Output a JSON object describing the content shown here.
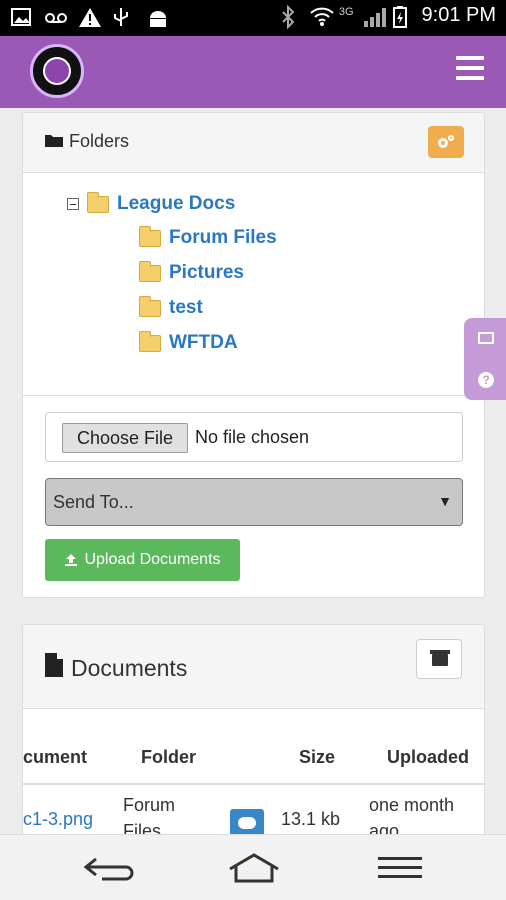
{
  "status_bar": {
    "network": "3G",
    "time": "9:01 PM"
  },
  "app_bar": {
    "logo_alt": "league logo",
    "menu_icon": "hamburger-menu-icon"
  },
  "folders_panel": {
    "title": "Folders",
    "tree": {
      "root": "League Docs",
      "children": [
        "Forum Files",
        "Pictures",
        "test",
        "WFTDA"
      ]
    }
  },
  "upload": {
    "choose_label": "Choose File",
    "no_file_text": "No file chosen",
    "send_to_value": "Send To...",
    "upload_label": "Upload Documents"
  },
  "documents_panel": {
    "title": "Documents",
    "columns": [
      "cument",
      "Folder",
      "Size",
      "Uploaded"
    ],
    "rows": [
      {
        "name": "c1-3.png",
        "folder_line1": "Forum",
        "folder_line2": "Files",
        "size": "13.1 kb",
        "uploaded_line1": "one month",
        "uploaded_line2": "ago"
      }
    ]
  },
  "colors": {
    "accent_purple": "#9b59b6",
    "link_blue": "#2a78c4",
    "upload_green": "#5cb85c",
    "gear_orange": "#f0ad4e"
  }
}
